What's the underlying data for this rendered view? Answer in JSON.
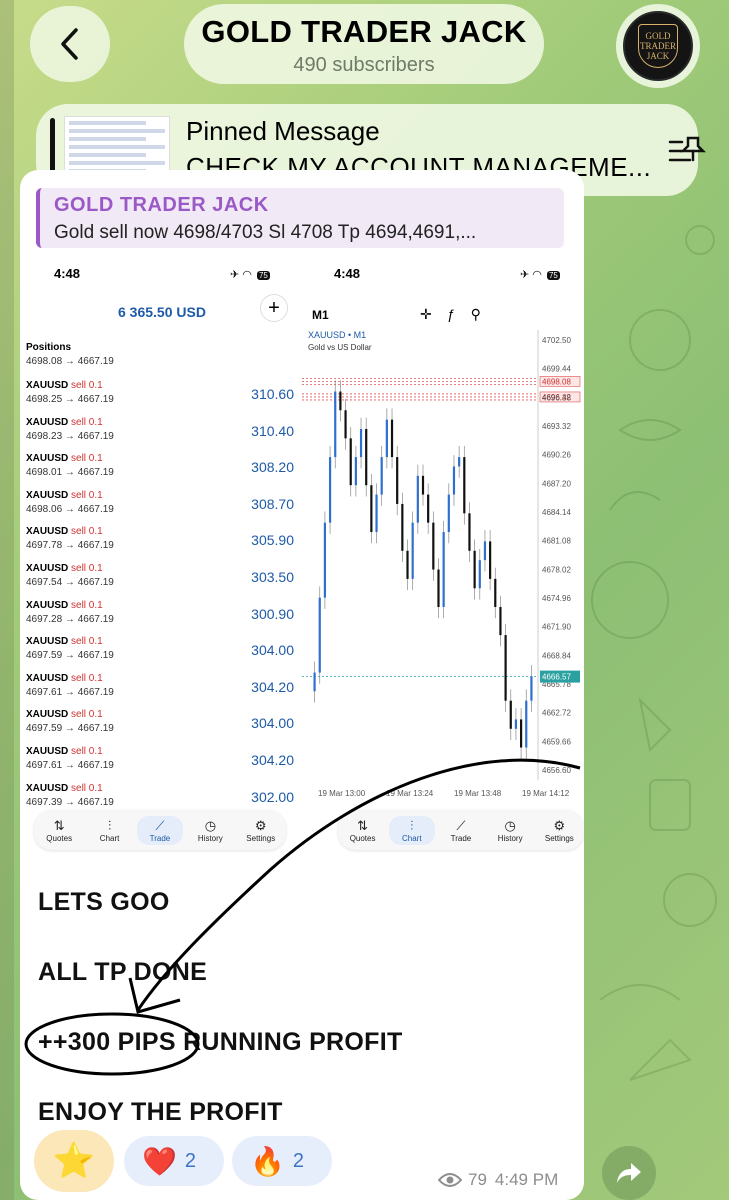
{
  "header": {
    "title": "GOLD TRADER JACK",
    "subscribers": "490 subscribers",
    "avatar_lines": [
      "GOLD",
      "TRADER",
      "JACK"
    ]
  },
  "pinned": {
    "title": "Pinned Message",
    "text": "CHECK MY ACCOUNT MANAGEME..."
  },
  "reply": {
    "name": "GOLD TRADER JACK",
    "text": "Gold sell now 4698/4703 Sl 4708 Tp 4694,4691,..."
  },
  "left_screen": {
    "time": "4:48",
    "battery": "75",
    "balance": "6 365.50 USD",
    "positions_label": "Positions",
    "first_price": "4698.08 → 4667.19",
    "positions": [
      {
        "symbol": "XAUUSD",
        "side": "sell 0.1",
        "prices": "4698.25 → 4667.19",
        "profit": "310.60"
      },
      {
        "symbol": "XAUUSD",
        "side": "sell 0.1",
        "prices": "4698.23 → 4667.19",
        "profit": "310.40"
      },
      {
        "symbol": "XAUUSD",
        "side": "sell 0.1",
        "prices": "4698.01 → 4667.19",
        "profit": "308.20"
      },
      {
        "symbol": "XAUUSD",
        "side": "sell 0.1",
        "prices": "4698.06 → 4667.19",
        "profit": "308.70"
      },
      {
        "symbol": "XAUUSD",
        "side": "sell 0.1",
        "prices": "4697.78 → 4667.19",
        "profit": "305.90"
      },
      {
        "symbol": "XAUUSD",
        "side": "sell 0.1",
        "prices": "4697.54 → 4667.19",
        "profit": "303.50"
      },
      {
        "symbol": "XAUUSD",
        "side": "sell 0.1",
        "prices": "4697.28 → 4667.19",
        "profit": "300.90"
      },
      {
        "symbol": "XAUUSD",
        "side": "sell 0.1",
        "prices": "4697.59 → 4667.19",
        "profit": "304.00"
      },
      {
        "symbol": "XAUUSD",
        "side": "sell 0.1",
        "prices": "4697.61 → 4667.19",
        "profit": "304.20"
      },
      {
        "symbol": "XAUUSD",
        "side": "sell 0.1",
        "prices": "4697.59 → 4667.19",
        "profit": "304.00"
      },
      {
        "symbol": "XAUUSD",
        "side": "sell 0.1",
        "prices": "4697.61 → 4667.19",
        "profit": "304.20"
      },
      {
        "symbol": "XAUUSD",
        "side": "sell 0.1",
        "prices": "4697.39 → 4667.19",
        "profit": "302.00"
      }
    ],
    "tabs": [
      "Quotes",
      "Chart",
      "Trade",
      "History",
      "Settings"
    ],
    "active_tab": "Trade"
  },
  "right_screen": {
    "time": "4:48",
    "battery": "75",
    "timeframe": "M1",
    "symbol": "XAUUSD • M1",
    "symbol_desc": "Gold vs US Dollar",
    "tabs": [
      "Quotes",
      "Chart",
      "Trade",
      "History",
      "Settings"
    ],
    "active_tab": "Chart",
    "current_price": "4666.57",
    "order_labels": [
      "4698.08",
      "4696.42"
    ]
  },
  "chart_data": {
    "type": "candlestick",
    "title": "",
    "symbol": "XAUUSD",
    "y_ticks": [
      "4702.50",
      "4699.44",
      "4696.38",
      "4693.32",
      "4690.26",
      "4687.20",
      "4684.14",
      "4681.08",
      "4678.02",
      "4674.96",
      "4671.90",
      "4668.84",
      "4665.78",
      "4662.72",
      "4659.66",
      "4656.60"
    ],
    "x_ticks": [
      "19 Mar 13:00",
      "19 Mar 13:24",
      "19 Mar 13:48",
      "19 Mar 14:12"
    ],
    "ylim": [
      4656.6,
      4702.5
    ],
    "close": [
      4667.0,
      4675.0,
      4683.0,
      4690.0,
      4697.0,
      4695.0,
      4692.0,
      4687.0,
      4690.0,
      4693.0,
      4687.0,
      4682.0,
      4686.0,
      4690.0,
      4694.0,
      4690.0,
      4685.0,
      4680.0,
      4677.0,
      4683.0,
      4688.0,
      4686.0,
      4683.0,
      4678.0,
      4674.0,
      4682.0,
      4686.0,
      4689.0,
      4690.0,
      4684.0,
      4680.0,
      4676.0,
      4679.0,
      4681.0,
      4677.0,
      4674.0,
      4671.0,
      4664.0,
      4661.0,
      4662.0,
      4659.0,
      4664.0,
      4666.6
    ],
    "current_price": 4666.57
  },
  "message": {
    "lines": [
      "LETS GOO",
      "ALL TP DONE",
      "++300 PIPS RUNNING PROFIT",
      "ENJOY THE PROFIT"
    ],
    "views": "79",
    "time": "4:49 PM"
  },
  "reactions": [
    {
      "emoji": "⭐",
      "count": ""
    },
    {
      "emoji": "❤️",
      "count": "2"
    },
    {
      "emoji": "🔥",
      "count": "2"
    }
  ],
  "colors": {
    "accent_purple": "#9b59c7",
    "profit_blue": "#1e5aa8",
    "sell_red": "#d03232",
    "bull_candle": "#2f6fd0",
    "bear_candle": "#111111"
  }
}
